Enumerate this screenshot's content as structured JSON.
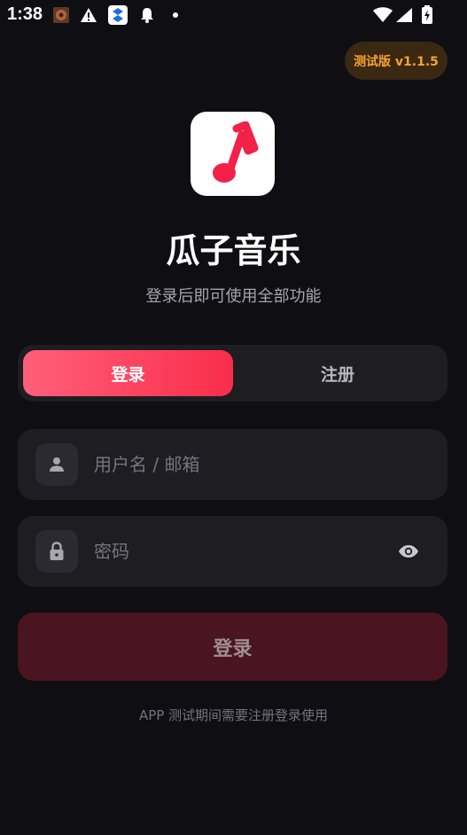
{
  "status_bar": {
    "time": "1:38"
  },
  "version_badge": {
    "label": "测试版 v1.1.5"
  },
  "app": {
    "name": "瓜子音乐",
    "subtitle": "登录后即可使用全部功能"
  },
  "tabs": [
    {
      "label": "登录",
      "active": true
    },
    {
      "label": "注册",
      "active": false
    }
  ],
  "form": {
    "username_placeholder": "用户名 / 邮箱",
    "username_value": "",
    "password_placeholder": "密码",
    "password_value": "",
    "submit_label": "登录"
  },
  "footer": {
    "note": "APP 测试期间需要注册登录使用"
  },
  "colors": {
    "background": "#0f0e12",
    "accent": "#fa2d4b",
    "badge_text": "#f5a332"
  }
}
